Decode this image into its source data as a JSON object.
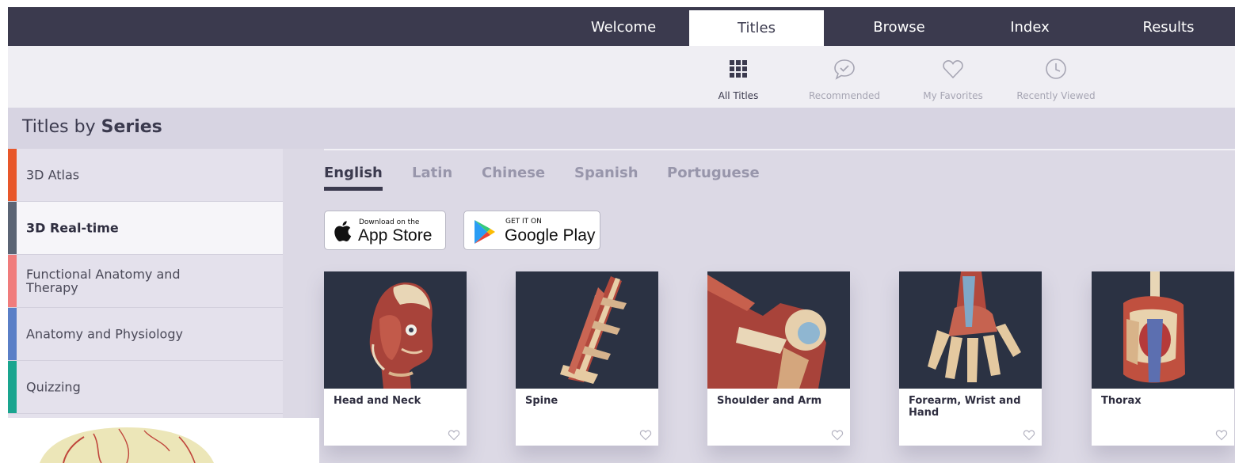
{
  "top_nav": {
    "tabs": [
      {
        "label": "Welcome",
        "active": false
      },
      {
        "label": "Titles",
        "active": true
      },
      {
        "label": "Browse",
        "active": false
      },
      {
        "label": "Index",
        "active": false
      },
      {
        "label": "Results",
        "active": false
      }
    ]
  },
  "sub_nav": {
    "items": [
      {
        "label": "All Titles",
        "icon": "grid-icon",
        "active": true
      },
      {
        "label": "Recommended",
        "icon": "chat-check-icon",
        "active": false
      },
      {
        "label": "My Favorites",
        "icon": "heart-icon",
        "active": false
      },
      {
        "label": "Recently Viewed",
        "icon": "clock-icon",
        "active": false
      }
    ]
  },
  "section": {
    "title_prefix": "Titles by",
    "title_bold": "Series"
  },
  "sidebar": {
    "items": [
      {
        "label": "3D Atlas",
        "color": "#e8572a",
        "active": false
      },
      {
        "label": "3D Real-time",
        "color": "#5b6474",
        "active": true
      },
      {
        "label": "Functional Anatomy and Therapy",
        "color": "#f07c7c",
        "active": false
      },
      {
        "label": "Anatomy and Physiology",
        "color": "#5a7fc7",
        "active": false
      },
      {
        "label": "Quizzing",
        "color": "#1aa58f",
        "active": false
      }
    ]
  },
  "languages": {
    "tabs": [
      {
        "label": "English",
        "active": true
      },
      {
        "label": "Latin",
        "active": false
      },
      {
        "label": "Chinese",
        "active": false
      },
      {
        "label": "Spanish",
        "active": false
      },
      {
        "label": "Portuguese",
        "active": false
      }
    ]
  },
  "stores": {
    "apple": {
      "small": "Download on the",
      "big": "App Store",
      "icon": "apple-icon"
    },
    "google": {
      "small": "GET IT ON",
      "big": "Google Play",
      "icon": "google-play-icon"
    }
  },
  "cards": [
    {
      "title": "Head and Neck"
    },
    {
      "title": "Spine"
    },
    {
      "title": "Shoulder and Arm"
    },
    {
      "title": "Forearm, Wrist and Hand"
    },
    {
      "title": "Thorax"
    }
  ],
  "colors": {
    "nav_bg": "#3b3a4e",
    "band_bg": "#d7d4e2",
    "main_bg": "#dcd9e5",
    "card_thumb_bg": "#2b3243"
  }
}
